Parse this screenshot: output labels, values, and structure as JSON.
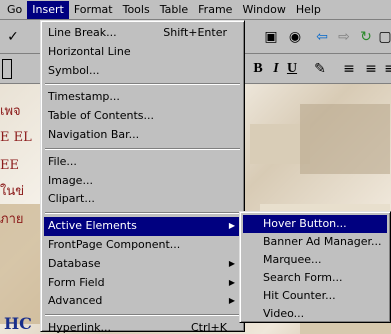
{
  "menubar": {
    "items": [
      {
        "label": "Go",
        "active": false
      },
      {
        "label": "Insert",
        "active": true
      },
      {
        "label": "Format",
        "active": false
      },
      {
        "label": "Tools",
        "active": false
      },
      {
        "label": "Table",
        "active": false
      },
      {
        "label": "Frame",
        "active": false
      },
      {
        "label": "Window",
        "active": false
      },
      {
        "label": "Help",
        "active": false
      }
    ]
  },
  "insert_menu": {
    "groups": [
      [
        {
          "label": "Line Break...",
          "shortcut": "Shift+Enter"
        },
        {
          "label": "Horizontal Line",
          "shortcut": ""
        },
        {
          "label": "Symbol...",
          "shortcut": ""
        }
      ],
      [
        {
          "label": "Timestamp...",
          "shortcut": ""
        },
        {
          "label": "Table of Contents...",
          "shortcut": ""
        },
        {
          "label": "Navigation Bar...",
          "shortcut": ""
        }
      ],
      [
        {
          "label": "File...",
          "shortcut": ""
        },
        {
          "label": "Image...",
          "shortcut": ""
        },
        {
          "label": "Clipart...",
          "shortcut": ""
        }
      ],
      [
        {
          "label": "Active Elements",
          "shortcut": "",
          "submenu": true,
          "highlighted": true
        },
        {
          "label": "FrontPage Component...",
          "shortcut": ""
        },
        {
          "label": "Database",
          "shortcut": "",
          "submenu": true
        },
        {
          "label": "Form Field",
          "shortcut": "",
          "submenu": true
        },
        {
          "label": "Advanced",
          "shortcut": "",
          "submenu": true
        }
      ],
      [
        {
          "label": "Hyperlink...",
          "shortcut": "Ctrl+K"
        }
      ]
    ]
  },
  "active_elements_submenu": {
    "items": [
      {
        "label": "Hover Button...",
        "highlighted": true
      },
      {
        "label": "Banner Ad Manager...",
        "highlighted": false
      },
      {
        "label": "Marquee...",
        "highlighted": false
      },
      {
        "label": "Search Form...",
        "highlighted": false
      },
      {
        "label": "Hit Counter...",
        "highlighted": false
      },
      {
        "label": "Video...",
        "highlighted": false
      }
    ]
  },
  "toolbar": {
    "bold": "B",
    "italic": "I",
    "underline": "U"
  },
  "document": {
    "fragments": [
      "เพจ",
      "E EL",
      "EE",
      "ในข่",
      "ภาย",
      "HC"
    ]
  },
  "colors": {
    "menu_bg": "#c0c0c0",
    "highlight": "#000080",
    "highlight_text": "#ffffff"
  }
}
